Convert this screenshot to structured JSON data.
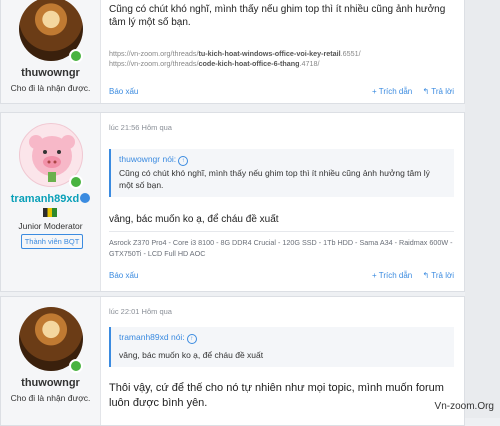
{
  "post1": {
    "username": "thuwowngr",
    "user_title": "Cho đi là nhận được.",
    "message": "Cũng có chút khó nghĩ, mình thấy nếu ghim top thì ít nhiều cũng ảnh hưởng tâm lý một số bạn.",
    "link1_prefix": "https://vn-zoom.org/threads/",
    "link1_bold": "tu-kich-hoat-windows-office-voi-key-retail",
    "link1_suffix": ".6551/",
    "link2_prefix": "https://vn-zoom.org/threads/",
    "link2_bold": "code-kich-hoat-office-6-thang",
    "link2_suffix": ".4718/",
    "report": "Báo xấu",
    "quote_action": "+ Trích dẫn",
    "reply_action": "↰ Trả lời"
  },
  "post2": {
    "date": "lúc 21:56 Hôm qua",
    "username": "tramanh89xd",
    "user_title": "Junior Moderator",
    "rank": "Thành viên BQT",
    "quote_author": "thuwowngr nói:",
    "quote_text": "Cũng có chút khó nghĩ, mình thấy nếu ghim top thì ít nhiều cũng ảnh hưởng tâm lý một số bạn.",
    "message": "vâng, bác muốn ko ạ, để cháu đề xuất",
    "signature": "Asrock Z370 Pro4 - Core i3 8100 - 8G DDR4 Crucial - 120G SSD - 1Tb HDD - Sama A34 - Raidmax 600W - GTX750Ti - LCD Full HD AOC",
    "report": "Báo xấu",
    "quote_action": "+ Trích dẫn",
    "reply_action": "↰ Trả lời"
  },
  "post3": {
    "date": "lúc 22:01 Hôm qua",
    "username": "thuwowngr",
    "user_title": "Cho đi là nhận được.",
    "quote_author": "tramanh89xd nói:",
    "quote_text": "vâng, bác muốn ko ạ, để cháu đề xuất",
    "message": "Thôi vậy, cứ để thế cho nó tự nhiên như mọi topic, mình muốn forum luôn được bình yên."
  },
  "watermark": "Vn-zoom.Org"
}
